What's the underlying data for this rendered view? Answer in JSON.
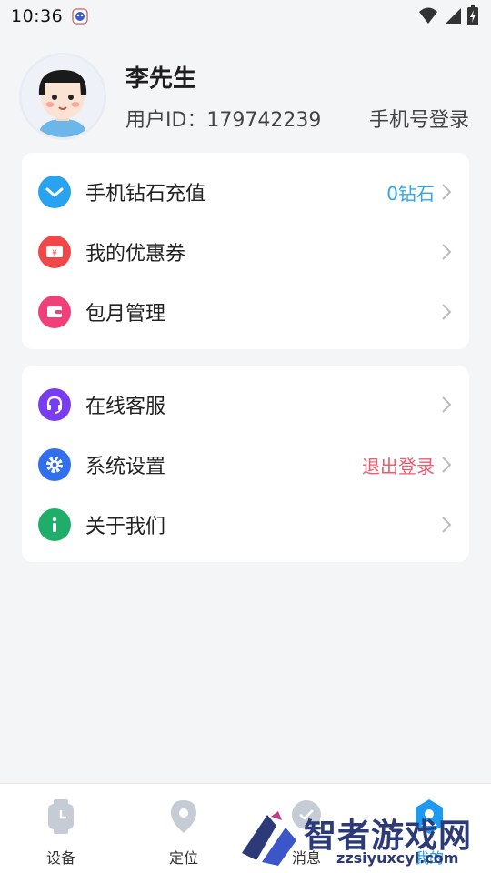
{
  "status_bar": {
    "time": "10:36",
    "icons": [
      "app-notification-icon",
      "wifi-icon",
      "cell-signal-icon",
      "battery-charging-icon"
    ]
  },
  "profile": {
    "name": "李先生",
    "user_id": "用户ID：179742239",
    "login_link": "手机号登录"
  },
  "menu_group_1": [
    {
      "label": "手机钻石充值",
      "value": "0钻石",
      "icon": "diamond-icon",
      "icon_color": "#29a3ef",
      "value_color": "#2fa8e8"
    },
    {
      "label": "我的优惠券",
      "value": "",
      "icon": "coupon-icon",
      "icon_color": "#f04848",
      "value_color": ""
    },
    {
      "label": "包月管理",
      "value": "",
      "icon": "wallet-icon",
      "icon_color": "#f0407a",
      "value_color": ""
    }
  ],
  "menu_group_2": [
    {
      "label": "在线客服",
      "value": "",
      "icon": "headset-icon",
      "icon_color": "#7a3cf0",
      "value_color": ""
    },
    {
      "label": "系统设置",
      "value": "退出登录",
      "icon": "gear-icon",
      "icon_color": "#2f6ff0",
      "value_color": "#ef5a6c"
    },
    {
      "label": "关于我们",
      "value": "",
      "icon": "info-icon",
      "icon_color": "#1fae6a",
      "value_color": ""
    }
  ],
  "bottom_nav": [
    {
      "label": "设备",
      "icon": "watch-icon"
    },
    {
      "label": "定位",
      "icon": "location-pin-icon"
    },
    {
      "label": "消息",
      "icon": "message-icon"
    },
    {
      "label": "我的",
      "icon": "profile-hexagon-icon"
    }
  ],
  "watermark": {
    "title": "智者游戏网",
    "url": "zzsiyuxcyl.com"
  },
  "colors": {
    "background": "#f4f5f7",
    "card": "#ffffff",
    "accent_blue": "#2fa8e8",
    "logout_red": "#ef5a6c"
  }
}
